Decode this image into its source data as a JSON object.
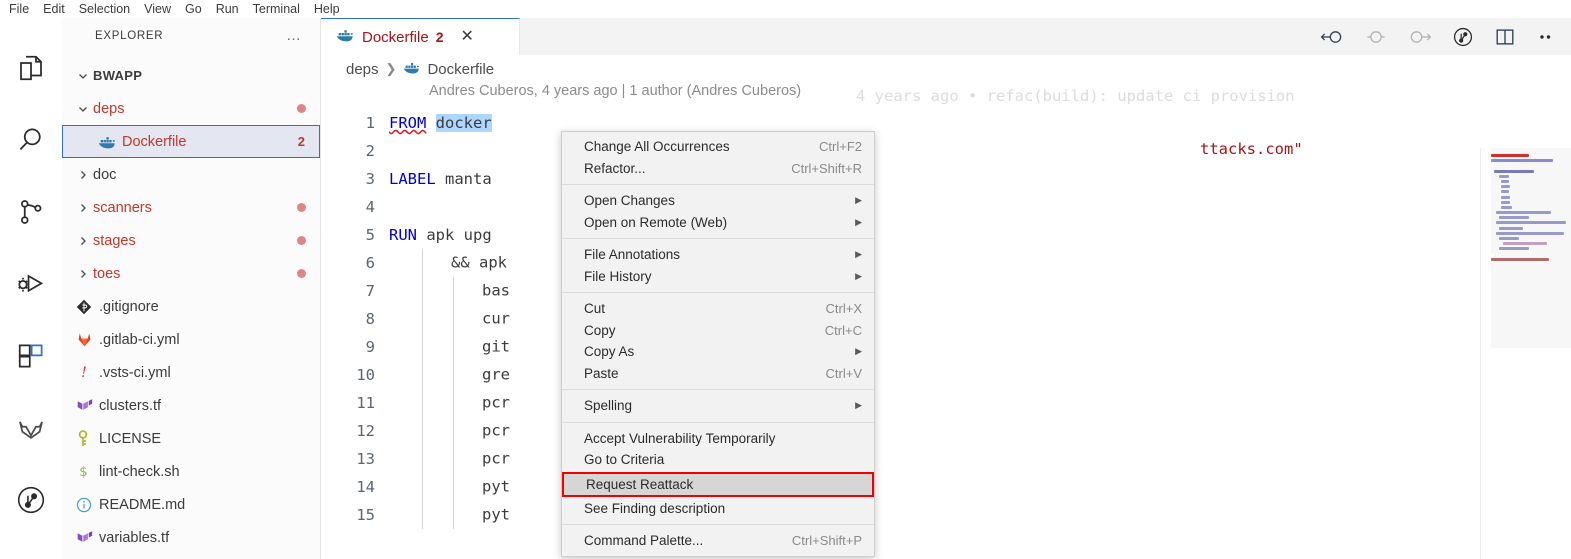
{
  "menubar": {
    "items": [
      "File",
      "Edit",
      "Selection",
      "View",
      "Go",
      "Run",
      "Terminal",
      "Help"
    ]
  },
  "activitybar": {
    "items": [
      {
        "name": "explorer-icon",
        "label": "Explorer"
      },
      {
        "name": "search-icon",
        "label": "Search"
      },
      {
        "name": "source-control-icon",
        "label": "Source Control"
      },
      {
        "name": "run-and-debug-icon",
        "label": "Run and Debug"
      },
      {
        "name": "extensions-icon",
        "label": "Extensions"
      },
      {
        "name": "gitlab-icon",
        "label": "GitLab Workflow"
      },
      {
        "name": "git-graph-icon",
        "label": "Git Graph"
      }
    ]
  },
  "sidebar": {
    "title": "EXPLORER",
    "more_actions": "…",
    "root": {
      "label": "BWAPP",
      "expanded": true
    },
    "tree": [
      {
        "label": "deps",
        "type": "folder",
        "expanded": true,
        "indent": 1,
        "error": true,
        "state": "error-dot"
      },
      {
        "label": "Dockerfile",
        "type": "file",
        "icon": "docker-icon",
        "indent": 2,
        "error": true,
        "selected": true,
        "badge": "2"
      },
      {
        "label": "doc",
        "type": "folder",
        "expanded": false,
        "indent": 1,
        "error": false,
        "state": "none"
      },
      {
        "label": "scanners",
        "type": "folder",
        "expanded": false,
        "indent": 1,
        "error": true,
        "state": "error-dot"
      },
      {
        "label": "stages",
        "type": "folder",
        "expanded": false,
        "indent": 1,
        "error": true,
        "state": "error-dot"
      },
      {
        "label": "toes",
        "type": "folder",
        "expanded": false,
        "indent": 1,
        "error": true,
        "state": "error-dot"
      },
      {
        "label": ".gitignore",
        "type": "file",
        "icon": "git-icon",
        "indent": 1
      },
      {
        "label": ".gitlab-ci.yml",
        "type": "file",
        "icon": "gitlab-fox-icon",
        "indent": 1
      },
      {
        "label": ".vsts-ci.yml",
        "type": "file",
        "icon": "exclamation-icon",
        "indent": 1
      },
      {
        "label": "clusters.tf",
        "type": "file",
        "icon": "terraform-icon",
        "indent": 1
      },
      {
        "label": "LICENSE",
        "type": "file",
        "icon": "key-icon",
        "indent": 1
      },
      {
        "label": "lint-check.sh",
        "type": "file",
        "icon": "shell-icon",
        "indent": 1
      },
      {
        "label": "README.md",
        "type": "file",
        "icon": "info-icon",
        "indent": 1
      },
      {
        "label": "variables.tf",
        "type": "file",
        "icon": "terraform-icon",
        "indent": 1
      }
    ]
  },
  "editor": {
    "tab": {
      "title": "Dockerfile",
      "badge": "2",
      "close": "✕",
      "icon": "docker-icon"
    },
    "toolbar": [
      {
        "name": "previous-change-icon",
        "label": "Previous Change"
      },
      {
        "name": "change-marker-icon",
        "label": "Change"
      },
      {
        "name": "next-change-icon",
        "label": "Next Change"
      },
      {
        "name": "file-history-icon",
        "label": "File History"
      },
      {
        "name": "split-editor-icon",
        "label": "Split Editor Right"
      },
      {
        "name": "more-actions-icon",
        "label": "More Actions..."
      }
    ],
    "breadcrumb": [
      "deps",
      "Dockerfile"
    ],
    "blame_header": "Andres Cuberos, 4 years ago | 1 author (Andres Cuberos)",
    "inline_blame": "4 years ago • refac(build): update ci provision",
    "lines": [
      {
        "num": "1",
        "indent": 0,
        "tokens": [
          {
            "t": "FROM",
            "c": "kw squiggle"
          },
          {
            "t": " ",
            "c": ""
          },
          {
            "t": "docker",
            "c": "sel"
          }
        ]
      },
      {
        "num": "2",
        "indent": 0,
        "tokens": []
      },
      {
        "num": "3",
        "indent": 0,
        "tokens": [
          {
            "t": "LABEL",
            "c": "kw"
          },
          {
            "t": " ",
            "c": ""
          },
          {
            "t": "manta",
            "c": ""
          }
        ]
      },
      {
        "num": "4",
        "indent": 0,
        "tokens": []
      },
      {
        "num": "5",
        "indent": 0,
        "tokens": [
          {
            "t": "RUN",
            "c": "kw"
          },
          {
            "t": " ",
            "c": ""
          },
          {
            "t": "apk upg",
            "c": ""
          }
        ]
      },
      {
        "num": "6",
        "indent": 1,
        "tokens": [
          {
            "t": "&& apk ",
            "c": ""
          }
        ]
      },
      {
        "num": "7",
        "indent": 2,
        "tokens": [
          {
            "t": "bas",
            "c": ""
          }
        ]
      },
      {
        "num": "8",
        "indent": 2,
        "tokens": [
          {
            "t": "cur",
            "c": ""
          }
        ]
      },
      {
        "num": "9",
        "indent": 2,
        "tokens": [
          {
            "t": "git",
            "c": ""
          }
        ]
      },
      {
        "num": "10",
        "indent": 2,
        "tokens": [
          {
            "t": "gre",
            "c": ""
          }
        ]
      },
      {
        "num": "11",
        "indent": 2,
        "tokens": [
          {
            "t": "pcr",
            "c": ""
          }
        ]
      },
      {
        "num": "12",
        "indent": 2,
        "tokens": [
          {
            "t": "pcr",
            "c": ""
          }
        ]
      },
      {
        "num": "13",
        "indent": 2,
        "tokens": [
          {
            "t": "pcr",
            "c": ""
          }
        ]
      },
      {
        "num": "14",
        "indent": 2,
        "tokens": [
          {
            "t": "pyt",
            "c": ""
          }
        ]
      },
      {
        "num": "15",
        "indent": 2,
        "tokens": [
          {
            "t": "pyt",
            "c": ""
          }
        ]
      }
    ],
    "line3_tail": "ttacks.com\""
  },
  "context_menu": {
    "groups": [
      [
        {
          "label": "Change All Occurrences",
          "shortcut": "Ctrl+F2",
          "submenu": false
        },
        {
          "label": "Refactor...",
          "shortcut": "Ctrl+Shift+R",
          "submenu": false
        }
      ],
      [
        {
          "label": "Open Changes",
          "shortcut": "",
          "submenu": true
        },
        {
          "label": "Open on Remote (Web)",
          "shortcut": "",
          "submenu": true
        }
      ],
      [
        {
          "label": "File Annotations",
          "shortcut": "",
          "submenu": true
        },
        {
          "label": "File History",
          "shortcut": "",
          "submenu": true
        }
      ],
      [
        {
          "label": "Cut",
          "shortcut": "Ctrl+X",
          "submenu": false
        },
        {
          "label": "Copy",
          "shortcut": "Ctrl+C",
          "submenu": false
        },
        {
          "label": "Copy As",
          "shortcut": "",
          "submenu": true
        },
        {
          "label": "Paste",
          "shortcut": "Ctrl+V",
          "submenu": false
        }
      ],
      [
        {
          "label": "Spelling",
          "shortcut": "",
          "submenu": true
        }
      ],
      [
        {
          "label": "Accept Vulnerability Temporarily",
          "shortcut": "",
          "submenu": false
        },
        {
          "label": "Go to Criteria",
          "shortcut": "",
          "submenu": false
        },
        {
          "label": "Request Reattack",
          "shortcut": "",
          "submenu": false,
          "highlighted": true
        },
        {
          "label": "See Finding description",
          "shortcut": "",
          "submenu": false
        }
      ],
      [
        {
          "label": "Command Palette...",
          "shortcut": "Ctrl+Shift+P",
          "submenu": false
        }
      ]
    ]
  },
  "colors": {
    "accent": "#2f72c4",
    "error": "#c0392b",
    "highlight_border": "#f00000",
    "selection": "#add6ff",
    "keyword": "#0000d0",
    "string": "#a3171c"
  }
}
